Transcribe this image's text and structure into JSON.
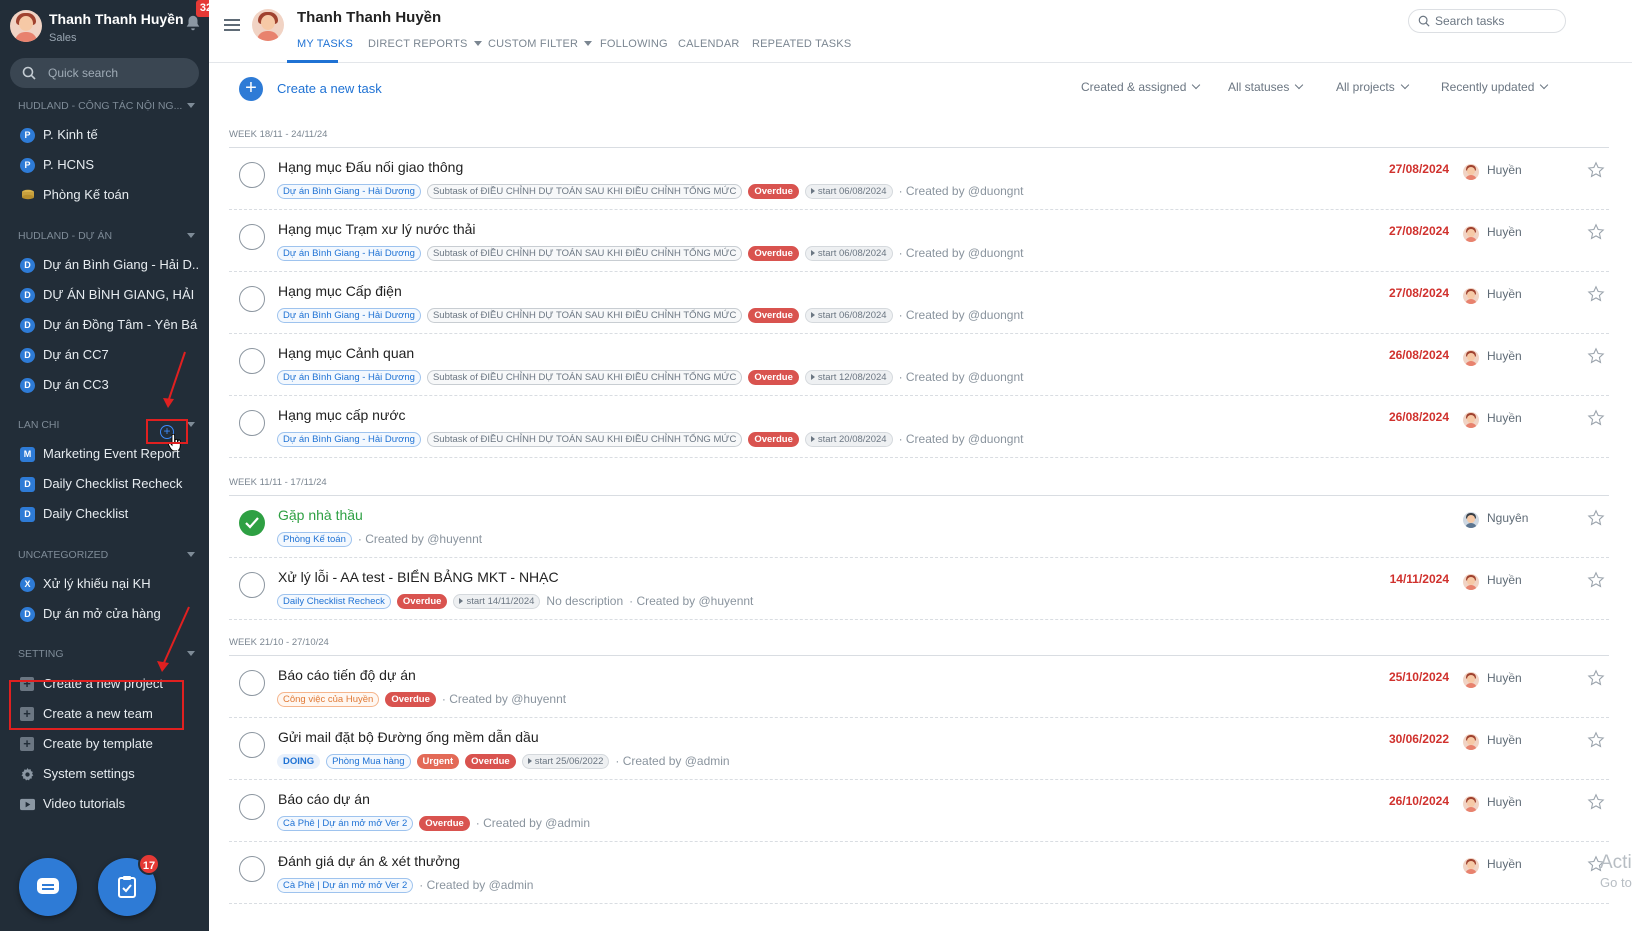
{
  "sidebar": {
    "user_name": "Thanh Thanh Huyền",
    "user_role": "Sales",
    "notifications": "32",
    "search_placeholder": "Quick search",
    "sections": [
      {
        "title": "HUDLAND - CÔNG TÁC NỘI NG...",
        "items": [
          {
            "label": "P. Kinh tế",
            "icon": "P"
          },
          {
            "label": "P. HCNS",
            "icon": "P"
          },
          {
            "label": "Phòng Kế toán",
            "icon": "coins-icon"
          }
        ]
      },
      {
        "title": "HUDLAND - DỰ ÁN",
        "items": [
          {
            "label": "Dự án Bình Giang - Hải D...",
            "icon": "D"
          },
          {
            "label": "DỰ ÁN BÌNH GIANG, HẢI ...",
            "icon": "D"
          },
          {
            "label": "Dự án Đồng Tâm - Yên Bái",
            "icon": "D"
          },
          {
            "label": "Dự án CC7",
            "icon": "D"
          },
          {
            "label": "Dự án CC3",
            "icon": "D"
          }
        ]
      },
      {
        "title": "LAN CHI",
        "items": [
          {
            "label": "Marketing Event Report",
            "icon": "M"
          },
          {
            "label": "Daily Checklist Recheck",
            "icon": "D"
          },
          {
            "label": "Daily Checklist",
            "icon": "D"
          }
        ]
      },
      {
        "title": "UNCATEGORIZED",
        "items": [
          {
            "label": "Xử lý khiếu nại KH",
            "icon": "X"
          },
          {
            "label": "Dự án mở cửa hàng",
            "icon": "D"
          }
        ]
      },
      {
        "title": "SETTING",
        "items": [
          {
            "label": "Create a new project",
            "icon": "plus-icon"
          },
          {
            "label": "Create a new team",
            "icon": "plus-icon"
          },
          {
            "label": "Create by template",
            "icon": "plus-icon"
          },
          {
            "label": "System settings",
            "icon": "gear-icon"
          },
          {
            "label": "Video tutorials",
            "icon": "video-icon"
          }
        ]
      }
    ],
    "tasks_badge": "17"
  },
  "header": {
    "title": "Thanh Thanh Huyền",
    "tabs": [
      "MY TASKS",
      "DIRECT REPORTS",
      "CUSTOM FILTER",
      "FOLLOWING",
      "CALENDAR",
      "REPEATED TASKS"
    ],
    "search_placeholder": "Search tasks"
  },
  "toolbar": {
    "create_label": "Create a new task",
    "filters": [
      "Created & assigned",
      "All statuses",
      "All projects",
      "Recently updated"
    ]
  },
  "weeks": [
    {
      "label": "WEEK 18/11 - 24/11/24",
      "tasks": [
        {
          "title": "Hạng mục Đấu nối giao thông",
          "project": "Dự án Bình Giang - Hải Dương",
          "parent": "Subtask of ĐIỀU CHỈNH DỰ TOÁN SAU KHI ĐIỀU CHỈNH TỔNG MỨC",
          "status": "Overdue",
          "start": "start 06/08/2024",
          "created": "· Created by @duongnt",
          "due": "27/08/2024",
          "assignee": "Huyền"
        },
        {
          "title": "Hạng mục Trạm xư lý nước thải",
          "project": "Dự án Bình Giang - Hải Dương",
          "parent": "Subtask of ĐIỀU CHỈNH DỰ TOÁN SAU KHI ĐIỀU CHỈNH TỔNG MỨC",
          "status": "Overdue",
          "start": "start 06/08/2024",
          "created": "· Created by @duongnt",
          "due": "27/08/2024",
          "assignee": "Huyền"
        },
        {
          "title": "Hạng mục Cấp điện",
          "project": "Dự án Bình Giang - Hải Dương",
          "parent": "Subtask of ĐIỀU CHỈNH DỰ TOÁN SAU KHI ĐIỀU CHỈNH TỔNG MỨC",
          "status": "Overdue",
          "start": "start 06/08/2024",
          "created": "· Created by @duongnt",
          "due": "27/08/2024",
          "assignee": "Huyền"
        },
        {
          "title": "Hạng mục Cảnh quan",
          "project": "Dự án Bình Giang - Hải Dương",
          "parent": "Subtask of ĐIỀU CHỈNH DỰ TOÁN SAU KHI ĐIỀU CHỈNH TỔNG MỨC",
          "status": "Overdue",
          "start": "start 12/08/2024",
          "created": "· Created by @duongnt",
          "due": "26/08/2024",
          "assignee": "Huyền"
        },
        {
          "title": "Hạng mục cấp nước",
          "project": "Dự án Bình Giang - Hải Dương",
          "parent": "Subtask of ĐIỀU CHỈNH DỰ TOÁN SAU KHI ĐIỀU CHỈNH TỔNG MỨC",
          "status": "Overdue",
          "start": "start 20/08/2024",
          "created": "· Created by @duongnt",
          "due": "26/08/2024",
          "assignee": "Huyền"
        }
      ]
    },
    {
      "label": "WEEK 11/11 - 17/11/24",
      "tasks": [
        {
          "title": "Gặp nhà thầu",
          "project": "Phòng Kế toán",
          "created": "· Created by @huyennt",
          "assignee": "Nguyên",
          "done": true
        },
        {
          "title": "Xử lý lỗi - AA test - BIỂN BẢNG MKT - NHẠC",
          "project": "Daily Checklist Recheck",
          "status": "Overdue",
          "start": "start 14/11/2024",
          "description": "No description",
          "created": "· Created by @huyennt",
          "due": "14/11/2024",
          "assignee": "Huyền"
        }
      ]
    },
    {
      "label": "WEEK 21/10 - 27/10/24",
      "tasks": [
        {
          "title": "Báo cáo tiến độ dự án",
          "project": "Công việc của Huyền",
          "status": "Overdue",
          "created": "· Created by @huyennt",
          "due": "25/10/2024",
          "assignee": "Huyền"
        },
        {
          "title": "Gửi mail đặt bộ Đường ống mềm dẫn dầu",
          "label_doing": "DOING",
          "project": "Phòng Mua hàng",
          "priority": "Urgent",
          "status": "Overdue",
          "start": "start 25/06/2022",
          "created": "· Created by @admin",
          "due": "30/06/2022",
          "assignee": "Huyền"
        },
        {
          "title": "Báo cáo dự án",
          "project": "Cà Phê | Dự án mở mở Ver 2",
          "status": "Overdue",
          "created": "· Created by @admin",
          "due": "26/10/2024",
          "assignee": "Huyền"
        },
        {
          "title": "Đánh giá dự án & xét thưởng",
          "project": "Cà Phê | Dự án mở mở Ver 2",
          "created": "· Created by @admin",
          "assignee": "Huyền"
        }
      ]
    }
  ],
  "watermark": {
    "line1": "Acti",
    "line2": "Go to"
  },
  "colors": {
    "sidebar_bg": "#222d38",
    "accent": "#2e7bd6",
    "overdue": "#d9534f",
    "due_date": "#d0312d",
    "done": "#2ea043"
  }
}
